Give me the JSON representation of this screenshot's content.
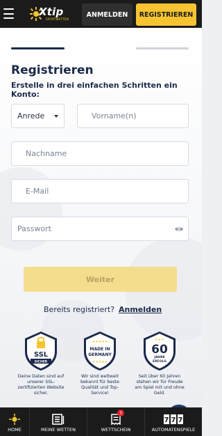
{
  "header": {
    "logo_text": "Xtip",
    "logo_sub": "SPORTWETTEN",
    "login_label": "ANMELDEN",
    "register_label": "REGISTRIEREN"
  },
  "progress": {
    "current_step": 1,
    "total_steps": 3
  },
  "form": {
    "title": "Registrieren",
    "subtitle": "Erstelle in drei einfachen Schritten ein Konto:",
    "salutation": {
      "value": "Anrede"
    },
    "firstname": {
      "placeholder": "Vorname(n)"
    },
    "lastname": {
      "placeholder": "Nachname"
    },
    "email": {
      "placeholder": "E-Mail"
    },
    "password": {
      "placeholder": "Passwort"
    },
    "submit_label": "Weiter",
    "already_text": "Bereits registriert?",
    "login_link": "Anmelden"
  },
  "trust": [
    {
      "badge_top": "SSL",
      "badge_bottom": "SICHER",
      "text": "Deine Daten sind auf unserer SSL-zertifizierten Website sicher."
    },
    {
      "badge_top": "MADE IN",
      "badge_bottom": "GERMANY",
      "text": "Wir sind weltweit bekannt für beste Qualität und Top-Service!"
    },
    {
      "badge_top": "60",
      "badge_mid": "JAHRE",
      "badge_bottom": "ERFOLG",
      "text": "Seit über 60 Jahren stehen wir für Freude am Spiel mit und ohne Geld."
    }
  ],
  "bottom_nav": [
    {
      "label": "HOME"
    },
    {
      "label": "MEINE WETTEN"
    },
    {
      "label": "WETTSCHEIN",
      "badge": "3"
    },
    {
      "label": "AUTOMATENSPIELE"
    }
  ],
  "colors": {
    "accent_yellow": "#f6c431",
    "navy": "#1c2a4a",
    "topbar": "#1b1b1b",
    "badge_red": "#e0202e"
  }
}
